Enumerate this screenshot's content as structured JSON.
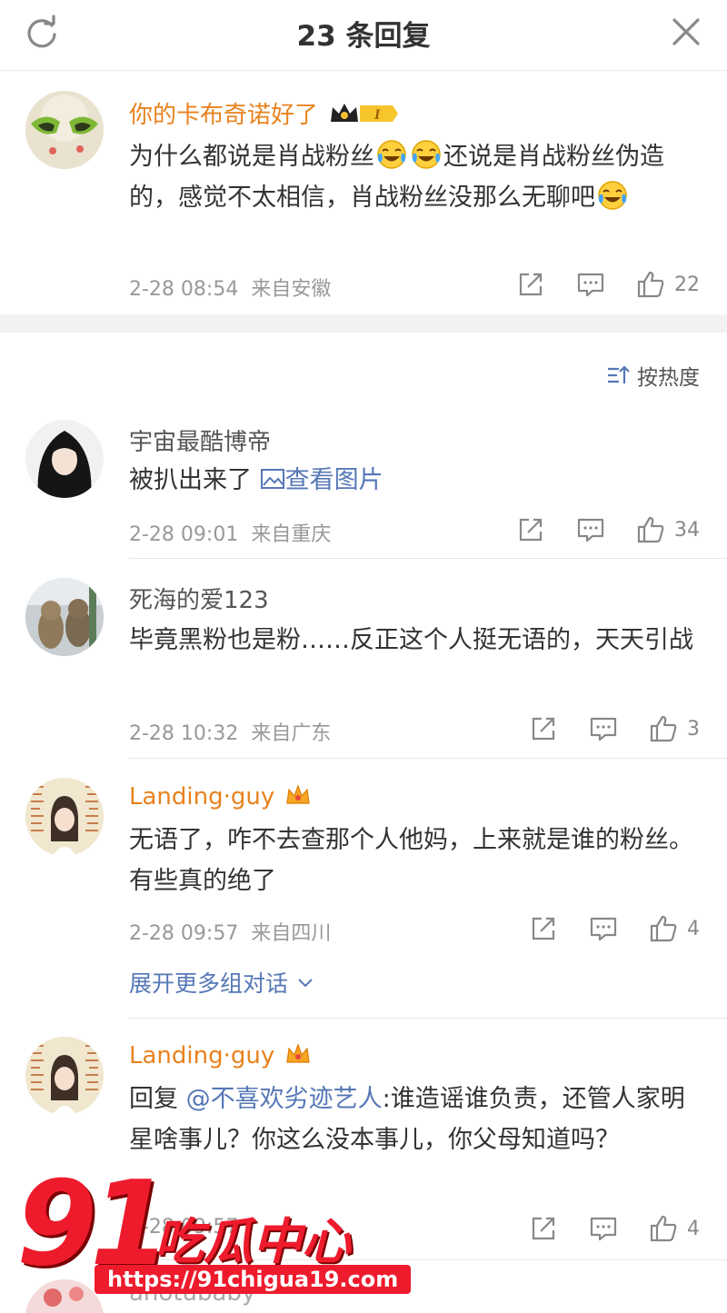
{
  "header": {
    "title": "23 条回复"
  },
  "top_comment": {
    "name": "你的卡布奇诺好了",
    "vip_badge": "I",
    "text_a": "为什么都说是肖战粉丝",
    "text_b": "还说是肖战粉丝伪造的，感觉不太相信，肖战粉丝没那么无聊吧",
    "time": "2-28 08:54",
    "location": "来自安徽",
    "likes": "22"
  },
  "sort": {
    "label": "按热度"
  },
  "comments": [
    {
      "name": "宇宙最酷博帝",
      "text": "被扒出来了",
      "link": "查看图片",
      "time": "2-28 09:01",
      "location": "来自重庆",
      "likes": "34"
    },
    {
      "name": "死海的爱123",
      "text": "毕竟黑粉也是粉……反正这个人挺无语的，天天引战",
      "time": "2-28 10:32",
      "location": "来自广东",
      "likes": "3"
    },
    {
      "name": "Landing·guy",
      "text": "无语了，咋不去查那个人他妈，上来就是谁的粉丝。有些真的绝了",
      "time": "2-28 09:57",
      "location": "来自四川",
      "likes": "4"
    },
    {
      "name": "Landing·guy",
      "reply_prefix": "回复 ",
      "mention": "@不喜欢劣迹艺人",
      "text": ":谁造谣谁负责，还管人家明星啥事儿？你这么没本事儿，你父母知道吗？",
      "time": "2-28 09:57",
      "likes": "4"
    }
  ],
  "expand": {
    "label": "展开更多组对话"
  },
  "partial_next": {
    "name": "anotubaby"
  },
  "watermark": {
    "number": "91",
    "brand": "吃瓜中心",
    "url": "https://91chigua19.com"
  },
  "colors": {
    "vip_name": "#e8821e",
    "link": "#5577b6",
    "watermark": "#ee1b2d"
  },
  "icons": [
    "refresh-icon",
    "close-icon",
    "share-icon",
    "comment-icon",
    "like-icon",
    "sort-icon",
    "image-icon",
    "chevron-down-icon",
    "crown-icon",
    "laughing-crying-emoji"
  ]
}
